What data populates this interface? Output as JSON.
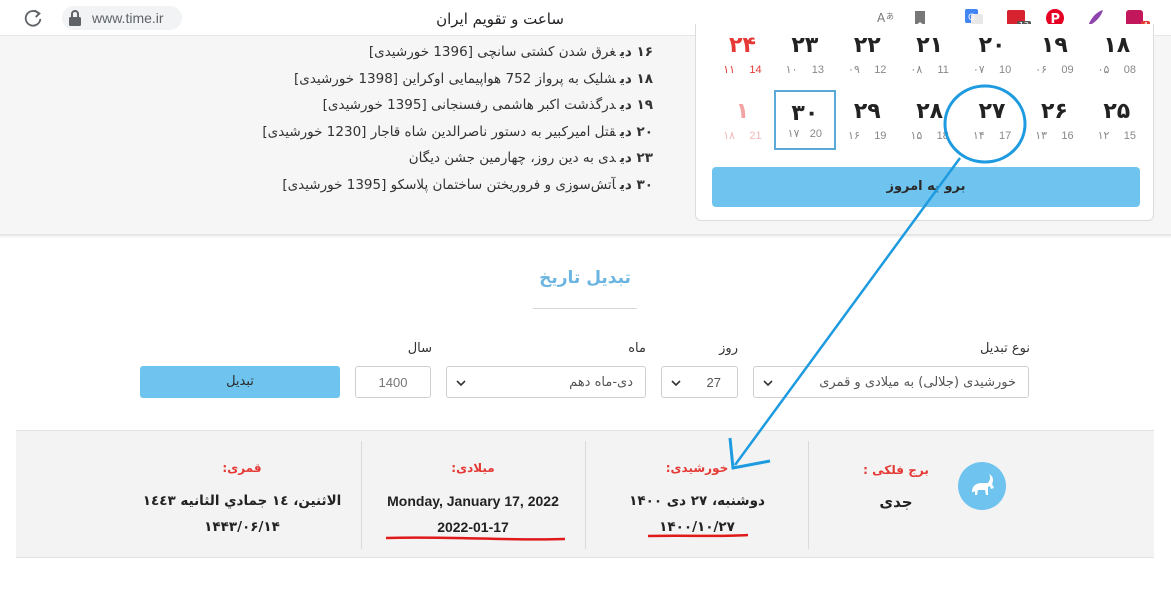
{
  "browser": {
    "url": "www.time.ir",
    "tab_title": "ساعت و تقویم ایران",
    "ext_badge_calendar": "13",
    "ext_badge_last": "4"
  },
  "events": [
    {
      "day": "۱۶ دی",
      "text": "غرق شدن کشتی سانچی [1396 خورشیدی]"
    },
    {
      "day": "۱۸ دی",
      "text": "شلیک به پرواز 752 هواپیمایی اوکراین [1398 خورشیدی]"
    },
    {
      "day": "۱۹ دی",
      "text": "درگذشت اکبر هاشمی رفسنجانی [1395 خورشیدی]"
    },
    {
      "day": "۲۰ دی",
      "text": "قتل امیرکبیر به دستور ناصرالدین شاه قاجار [1230 خورشیدی]"
    },
    {
      "day": "۲۳ دی",
      "text": "دی به دین روز، چهارمین جشن دیگان"
    },
    {
      "day": "۳۰ دی",
      "text": "آتش‌سوزی و فروریختن ساختمان پلاسکو [1395 خورشیدی]"
    }
  ],
  "calendar": {
    "row1": [
      {
        "big": "۱۸",
        "g": "08",
        "h": "۰۵"
      },
      {
        "big": "۱۹",
        "g": "09",
        "h": "۰۶"
      },
      {
        "big": "۲۰",
        "g": "10",
        "h": "۰۷"
      },
      {
        "big": "۲۱",
        "g": "11",
        "h": "۰۸"
      },
      {
        "big": "۲۲",
        "g": "12",
        "h": "۰۹"
      },
      {
        "big": "۲۳",
        "g": "13",
        "h": "۱۰"
      },
      {
        "big": "۲۴",
        "g": "14",
        "h": "۱۱"
      }
    ],
    "row2": [
      {
        "big": "۲۵",
        "g": "15",
        "h": "۱۲"
      },
      {
        "big": "۲۶",
        "g": "16",
        "h": "۱۳"
      },
      {
        "big": "۲۷",
        "g": "17",
        "h": "۱۴"
      },
      {
        "big": "۲۸",
        "g": "18",
        "h": "۱۵"
      },
      {
        "big": "۲۹",
        "g": "19",
        "h": "۱۶"
      },
      {
        "big": "۳۰",
        "g": "20",
        "h": "۱۷"
      },
      {
        "big": "۱",
        "g": "21",
        "h": "۱۸"
      }
    ],
    "today_button": "برو به امروز",
    "accent_color": "#6ec4ee",
    "holiday_color": "#e53935"
  },
  "converter": {
    "title": "تبدیل تاریخ",
    "type_label": "نوع تبدیل",
    "type_value": "خورشیدی (جلالی) به میلادی و قمری",
    "day_label": "روز",
    "day_value": "27",
    "month_label": "ماه",
    "month_value": "دی-ماه دهم",
    "year_label": "سال",
    "year_placeholder": "1400",
    "button": "تبدیل"
  },
  "results": {
    "zodiac_label": "برج فلکی :",
    "zodiac_value": "جدی",
    "shamsi_label": "خورشیدی:",
    "shamsi_line1": "دوشنبه، ۲۷ دی ۱۴۰۰",
    "shamsi_line2": "۱۴۰۰/۱۰/۲۷",
    "gregorian_label": "میلادی:",
    "gregorian_line1": "Monday, January 17, 2022",
    "gregorian_line2": "2022-01-17",
    "hijri_label": "قمری:",
    "hijri_line1": "الاثنين، ١٤ جمادي الثانيه ١٤٤٣",
    "hijri_line2": "۱۴۴۳/۰۶/۱۴"
  },
  "icons": [
    "reload-icon",
    "lock-icon",
    "translate-text-icon",
    "bookmark-icon",
    "google-translate-icon",
    "calendar-ext-icon",
    "pinterest-icon",
    "feather-icon",
    "extension-icon",
    "chevron-down-icon",
    "capricorn-goat-icon"
  ]
}
